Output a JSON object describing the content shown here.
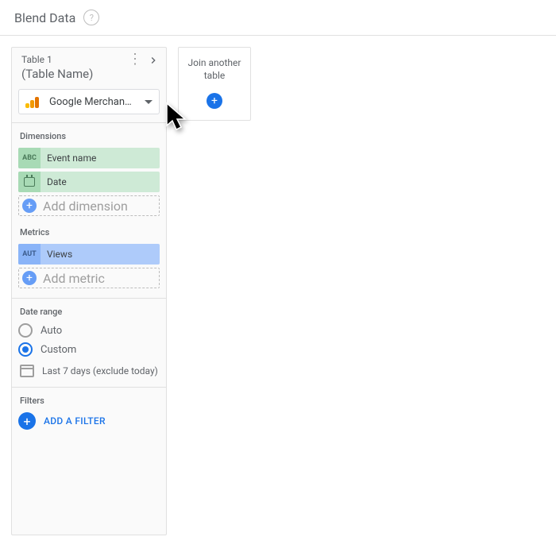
{
  "header": {
    "title": "Blend Data"
  },
  "table": {
    "index_label": "Table 1",
    "name": "(Table Name)",
    "source": "Google Merchan…"
  },
  "dimensions": {
    "section_label": "Dimensions",
    "items": [
      {
        "type": "ABC",
        "label": "Event name"
      },
      {
        "type": "CAL",
        "label": "Date"
      }
    ],
    "add_label": "Add dimension"
  },
  "metrics": {
    "section_label": "Metrics",
    "items": [
      {
        "type": "AUT",
        "label": "Views"
      }
    ],
    "add_label": "Add metric"
  },
  "date_range": {
    "section_label": "Date range",
    "auto_label": "Auto",
    "custom_label": "Custom",
    "selected": "custom",
    "value": "Last 7 days (exclude today)"
  },
  "filters": {
    "section_label": "Filters",
    "add_label": "ADD A FILTER"
  },
  "join": {
    "label": "Join another table"
  }
}
